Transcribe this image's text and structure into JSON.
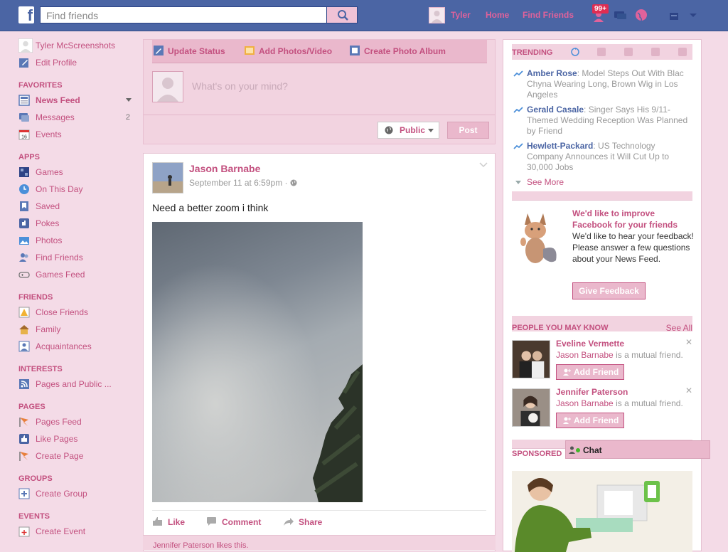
{
  "topbar": {
    "logo": "f",
    "search_placeholder": "Find friends",
    "user": "Tyler",
    "nav": [
      "Home",
      "Find Friends"
    ],
    "notifications_badge": "99+"
  },
  "leftnav": {
    "profile_name": "Tyler McScreenshots",
    "edit_profile": "Edit Profile",
    "favorites_head": "FAVORITES",
    "news_feed": "News Feed",
    "messages": "Messages",
    "messages_count": "2",
    "events": "Events",
    "apps_head": "APPS",
    "apps": [
      "Games",
      "On This Day",
      "Saved",
      "Pokes",
      "Photos",
      "Find Friends",
      "Games Feed"
    ],
    "friends_head": "FRIENDS",
    "friends": [
      "Close Friends",
      "Family",
      "Acquaintances"
    ],
    "interests_head": "INTERESTS",
    "interests": [
      "Pages and Public ..."
    ],
    "pages_head": "PAGES",
    "pages": [
      "Pages Feed",
      "Like Pages",
      "Create Page"
    ],
    "groups_head": "GROUPS",
    "groups": [
      "Create Group"
    ],
    "events_head": "EVENTS",
    "events_items": [
      "Create Event"
    ]
  },
  "composer": {
    "tabs": [
      "Update Status",
      "Add Photos/Video",
      "Create Photo Album"
    ],
    "placeholder": "What's on your mind?",
    "audience": "Public",
    "post": "Post"
  },
  "post": {
    "author": "Jason Barnabe",
    "time": "September 11 at 6:59pm · ",
    "text": "Need a better zoom i think",
    "actions": [
      "Like",
      "Comment",
      "Share"
    ],
    "likes": "Jennifer Paterson likes this."
  },
  "right": {
    "trending_head": "TRENDING",
    "trends": [
      {
        "name": "Amber Rose",
        "text": ": Model Steps Out With Blac Chyna Wearing Long, Brown Wig in Los Angeles"
      },
      {
        "name": "Gerald Casale",
        "text": ": Singer Says His 9/11-Themed Wedding Reception Was Planned by Friend"
      },
      {
        "name": "Hewlett-Packard",
        "text": ": US Technology Company Announces it Will Cut Up to 30,000 Jobs"
      }
    ],
    "see_more": "See More",
    "feedback_title": "We'd like to improve Facebook for your friends",
    "feedback_body": "We'd like to hear your feedback! Please answer a few questions about your News Feed.",
    "feedback_btn": "Give Feedback",
    "pymk_head": "PEOPLE YOU MAY KNOW",
    "see_all": "See All",
    "people": [
      {
        "name": "Eveline Vermette",
        "mutual_name": "Jason Barnabe",
        "mutual_text": " is a mutual friend.",
        "add": "Add Friend"
      },
      {
        "name": "Jennifer Paterson",
        "mutual_name": "Jason Barnabe",
        "mutual_text": " is a mutual friend.",
        "add": "Add Friend"
      }
    ],
    "sponsored": "SPONSORED",
    "chat": "Chat"
  }
}
